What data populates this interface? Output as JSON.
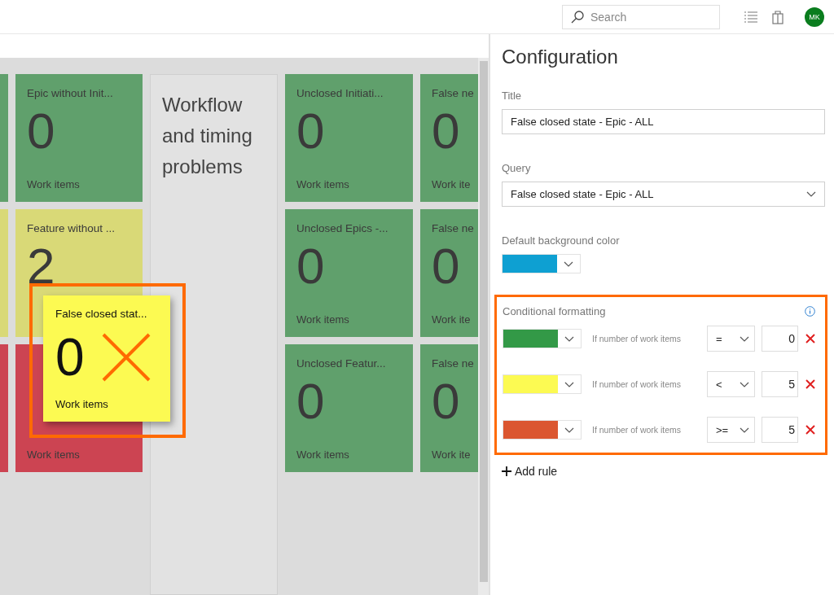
{
  "header": {
    "search": {
      "placeholder": "Search"
    },
    "avatar": "MK"
  },
  "dashboard": {
    "columns": [
      {
        "kind": "tiles",
        "tiles": [
          {
            "color": "#60a06c"
          },
          {
            "color": "#d9d977"
          },
          {
            "color": "#cc4452"
          }
        ]
      },
      {
        "kind": "tiles",
        "tiles": [
          {
            "title": "Epic without Init...",
            "count": "0",
            "footer": "Work items",
            "color": "#60a06c"
          },
          {
            "title": "Feature without ...",
            "count": "2",
            "color": "#d9d977"
          },
          {
            "footer": "Work items",
            "color": "#cc4452"
          }
        ]
      },
      {
        "kind": "group",
        "title": "Workflow and timing problems"
      },
      {
        "kind": "tiles",
        "tiles": [
          {
            "title": "Unclosed Initiati...",
            "count": "0",
            "footer": "Work items",
            "color": "#60a06c"
          },
          {
            "title": "Unclosed Epics -...",
            "count": "0",
            "footer": "Work items",
            "color": "#60a06c"
          },
          {
            "title": "Unclosed Featur...",
            "count": "0",
            "footer": "Work items",
            "color": "#60a06c"
          }
        ]
      },
      {
        "kind": "tiles",
        "tiles": [
          {
            "title": "False ne",
            "count": "0",
            "footer": "Work ite",
            "color": "#60a06c"
          },
          {
            "title": "False ne",
            "count": "0",
            "footer": "Work ite",
            "color": "#60a06c"
          },
          {
            "title": "False ne",
            "count": "0",
            "footer": "Work ite",
            "color": "#60a06c"
          }
        ]
      }
    ],
    "preview": {
      "title": "False closed stat...",
      "count": "0",
      "footer": "Work items",
      "color": "#fcfa52"
    }
  },
  "config": {
    "heading": "Configuration",
    "title_field": {
      "label": "Title",
      "value": "False closed state - Epic - ALL"
    },
    "query_field": {
      "label": "Query",
      "value": "False closed state - Epic - ALL"
    },
    "background": {
      "label": "Default background color",
      "color": "#0ea0d2"
    },
    "conditional": {
      "label": "Conditional formatting",
      "rules": [
        {
          "color": "#339947",
          "condition": "If number of work items",
          "operator": "=",
          "value": "0"
        },
        {
          "color": "#fcfa52",
          "condition": "If number of work items",
          "operator": "<",
          "value": "5"
        },
        {
          "color": "#db5630",
          "condition": "If number of work items",
          "operator": ">=",
          "value": "5"
        }
      ]
    },
    "add_rule": "Add rule"
  }
}
